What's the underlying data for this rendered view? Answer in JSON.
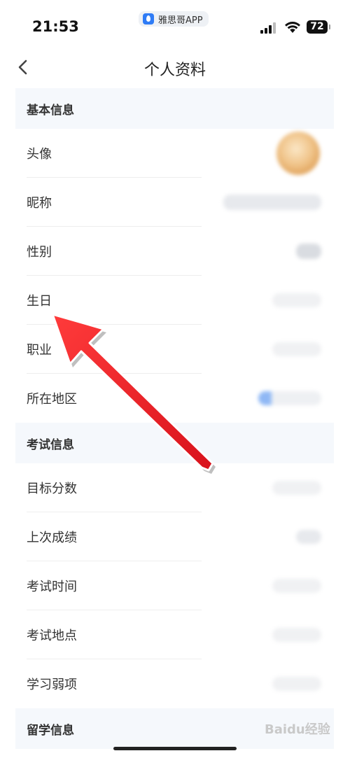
{
  "status_bar": {
    "time": "21:53",
    "app_name": "雅思哥APP",
    "battery": "72"
  },
  "nav": {
    "title": "个人资料"
  },
  "sections": {
    "basic": {
      "title": "基本信息",
      "rows": [
        "头像",
        "昵称",
        "性别",
        "生日",
        "职业",
        "所在地区"
      ]
    },
    "exam": {
      "title": "考试信息",
      "rows": [
        "目标分数",
        "上次成绩",
        "考试时间",
        "考试地点",
        "学习弱项"
      ]
    },
    "abroad": {
      "title": "留学信息"
    }
  },
  "watermark": "Baidu经验",
  "colors": {
    "section_bg": "#f5f8fc",
    "arrow": "#e8202a",
    "divider": "#eeeeee"
  }
}
